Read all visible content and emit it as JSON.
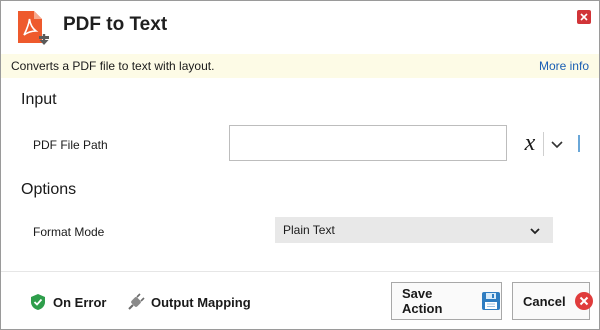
{
  "window": {
    "title": "PDF to Text",
    "description": "Converts a PDF file to text with layout.",
    "more_info_label": "More info"
  },
  "input_section": {
    "title": "Input",
    "pdf_file_path": {
      "label": "PDF File Path",
      "value": "",
      "placeholder": ""
    },
    "variable_symbol": "x"
  },
  "options_section": {
    "title": "Options",
    "format_mode": {
      "label": "Format Mode",
      "value": "Plain Text"
    }
  },
  "footer": {
    "on_error_label": "On Error",
    "output_mapping_label": "Output Mapping",
    "save_label": "Save Action",
    "cancel_label": "Cancel"
  },
  "colors": {
    "accent": "#1a5fb4",
    "pdf_icon": "#ee5a2d",
    "close_button": "#d13438",
    "on_error_shield": "#2e9e4b",
    "description_bg": "#fdfbe6"
  },
  "icons": {
    "app": "pdf-document-download-icon",
    "close": "close-icon",
    "on_error": "shield-check-icon",
    "output_mapping": "plug-icon",
    "save": "floppy-disk-icon",
    "cancel": "cancel-x-circle-icon"
  }
}
